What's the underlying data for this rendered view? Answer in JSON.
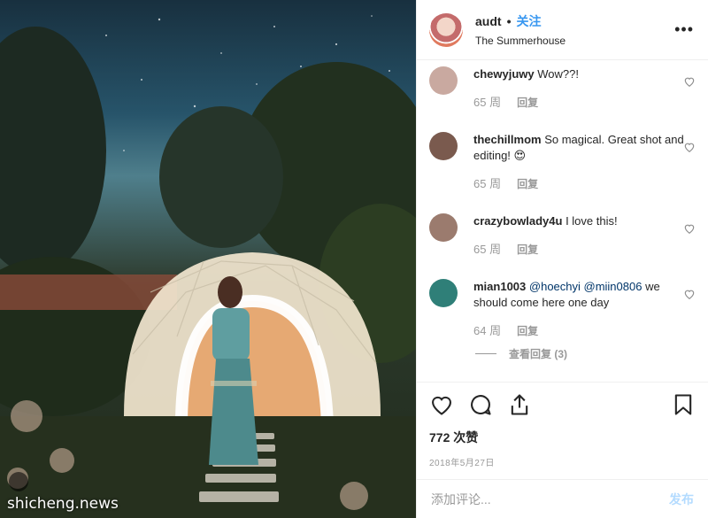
{
  "photo": {
    "watermark": "shicheng.news",
    "alt_subject": "Woman in teal outfit in front of illuminated geodesic dome under starry sky"
  },
  "header": {
    "username": "audt",
    "separator": "•",
    "follow_label": "关注",
    "location": "The Summerhouse",
    "more_icon": "more-horizontal-icon"
  },
  "comments": [
    {
      "user": "chewyjuwy",
      "text": "Wow??!",
      "mention": "",
      "time": "65 周",
      "reply": "回复",
      "avatar_color": "#c9a9a0"
    },
    {
      "user": "thechillmom",
      "text": "So magical. Great shot and editing! 😍",
      "mention": "",
      "time": "65 周",
      "reply": "回复",
      "avatar_color": "#7a5a4e"
    },
    {
      "user": "crazybowlady4u",
      "text": "I love this!",
      "mention": "",
      "time": "65 周",
      "reply": "回复",
      "avatar_color": "#9b7b6e"
    },
    {
      "user": "mian1003",
      "text": "we should come here one day",
      "mention": "@hoechyi @miin0806",
      "time": "64 周",
      "reply": "回复",
      "avatar_color": "#2f7f78"
    }
  ],
  "view_replies": "查看回复 (3)",
  "actions": {
    "like_icon": "heart-icon",
    "comment_icon": "comment-icon",
    "share_icon": "share-icon",
    "save_icon": "bookmark-icon",
    "likes": "772 次赞",
    "date": "2018年5月27日"
  },
  "add_comment": {
    "placeholder": "添加评论...",
    "post_label": "发布"
  },
  "colors": {
    "accent": "#3897f0",
    "muted": "#999999",
    "text": "#262626",
    "post_disabled": "#b3dbff"
  }
}
